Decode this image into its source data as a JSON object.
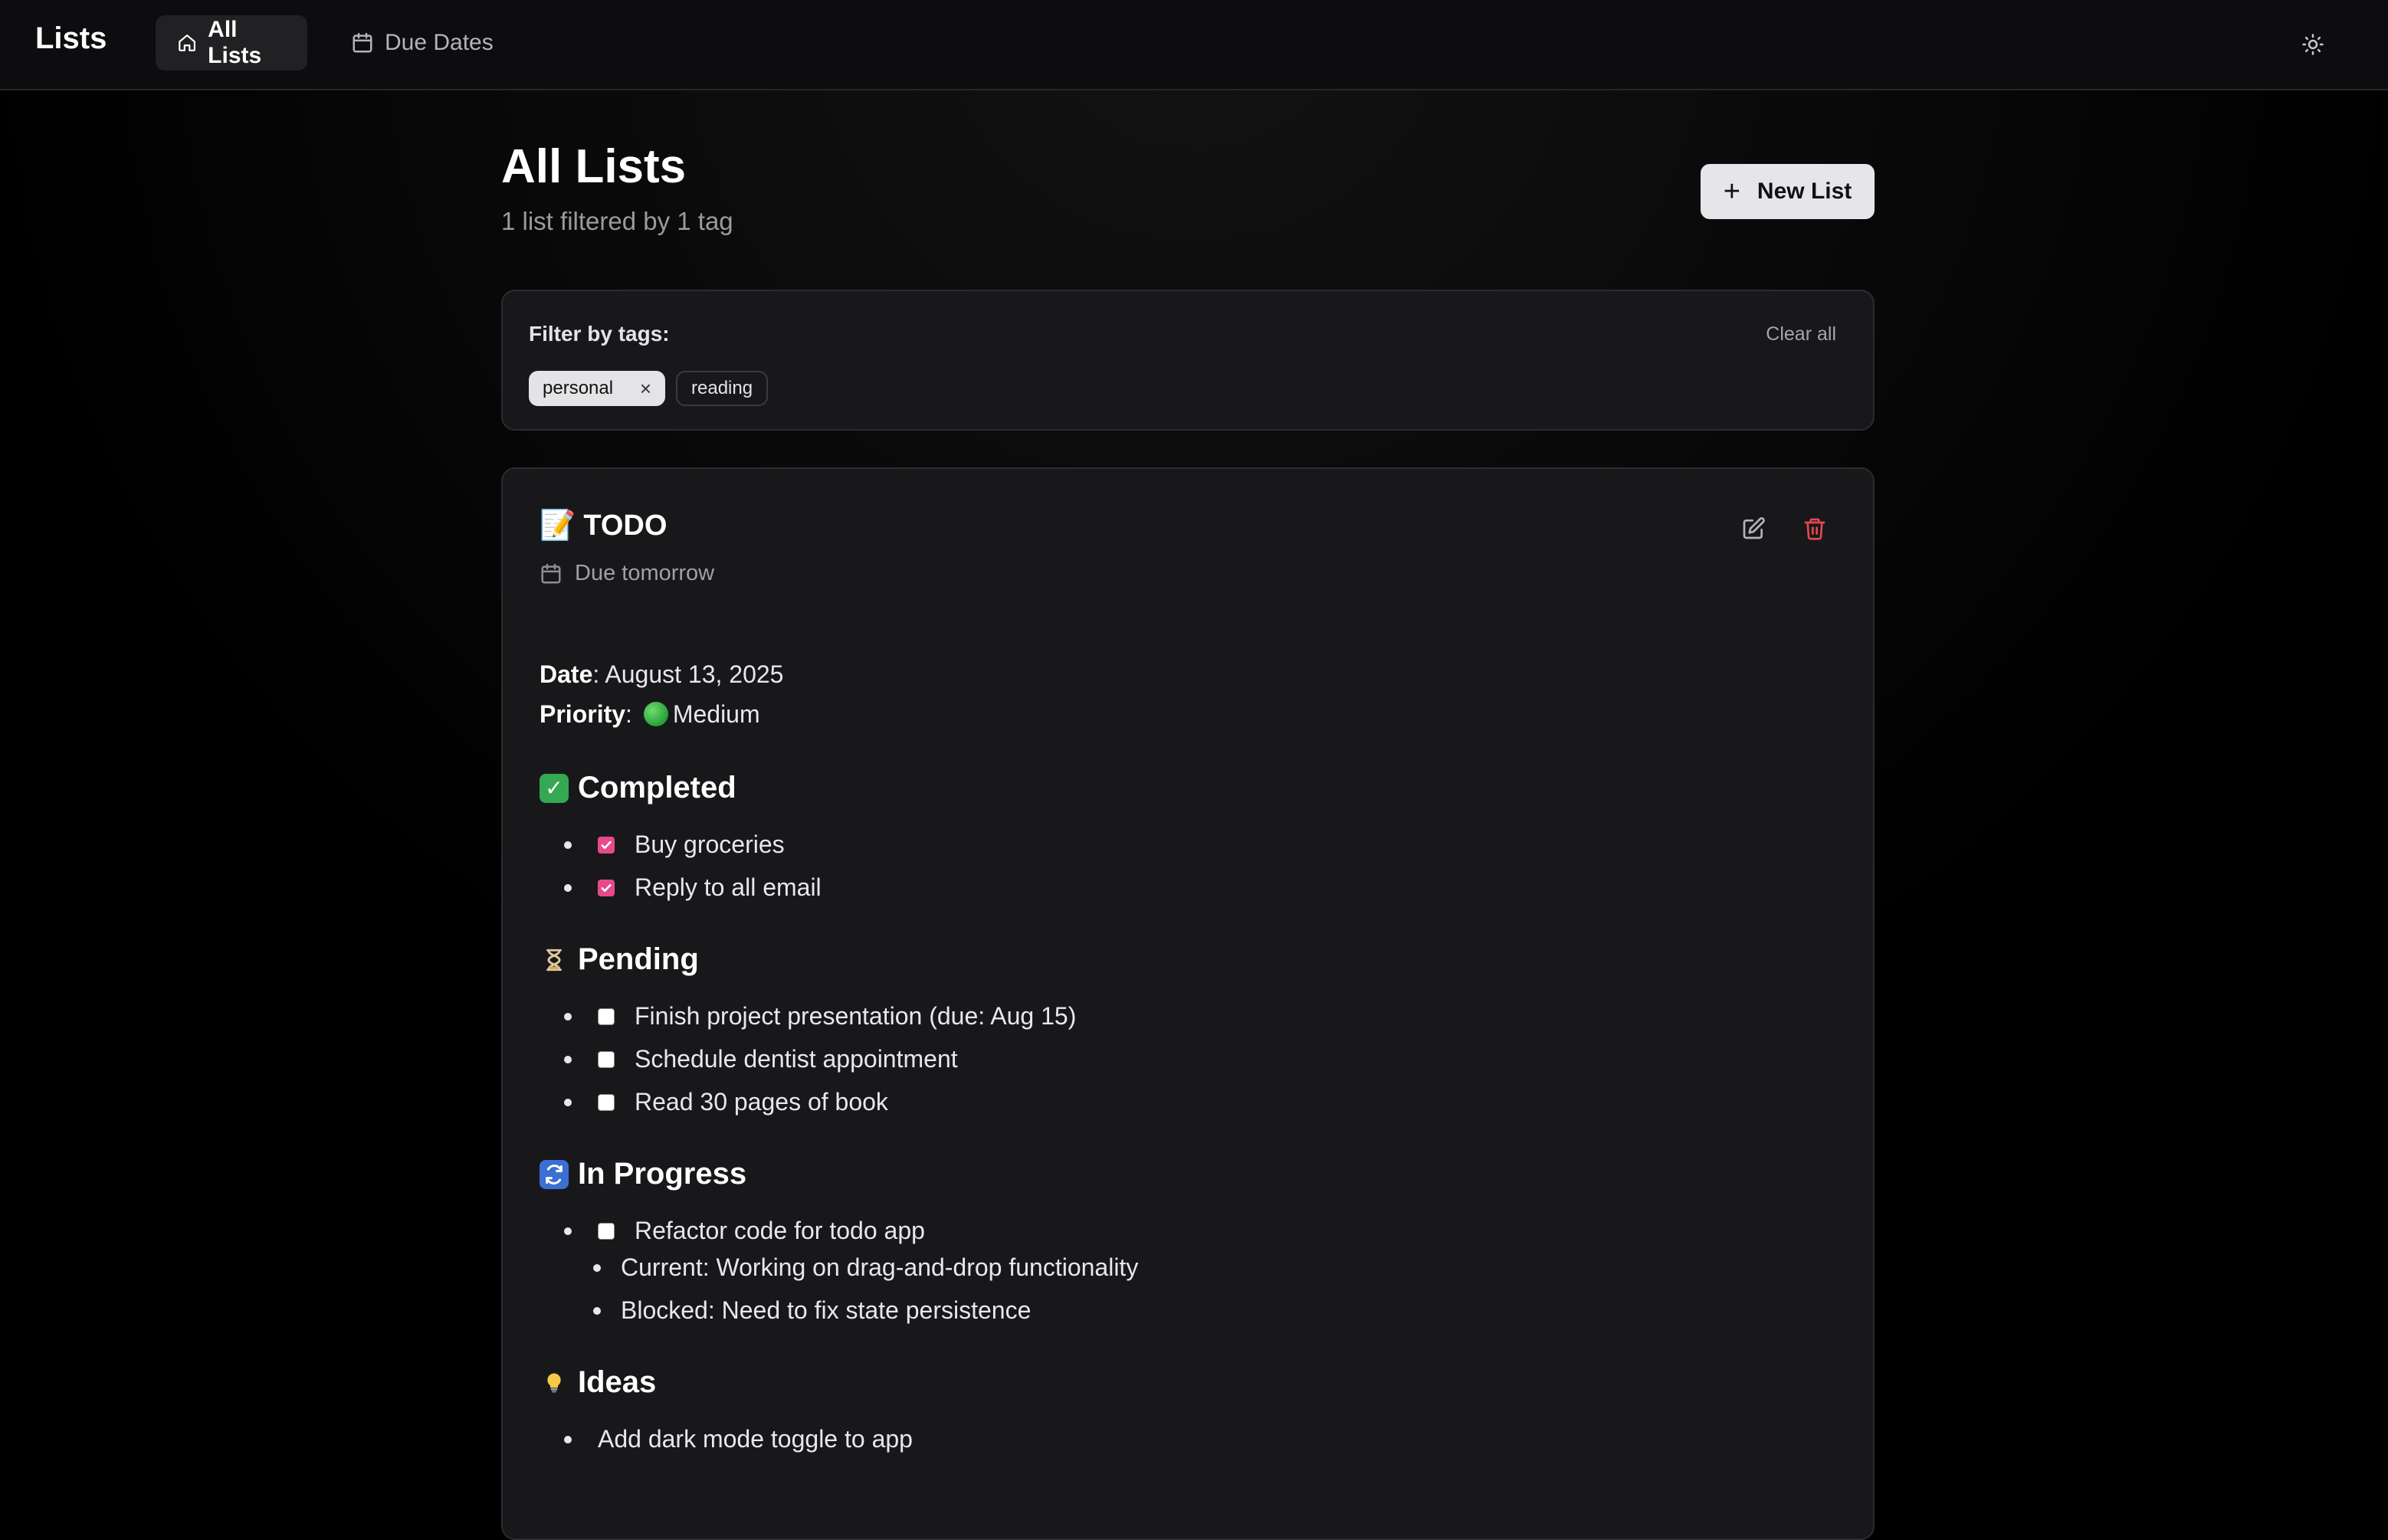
{
  "nav": {
    "brand": "Lists",
    "items": [
      {
        "label": "All Lists",
        "icon": "home-icon",
        "active": true
      },
      {
        "label": "Due Dates",
        "icon": "calendar-icon",
        "active": false
      }
    ],
    "theme_toggle_icon": "sun-icon"
  },
  "header": {
    "title": "All Lists",
    "subtitle": "1 list filtered by 1 tag",
    "new_list_label": "New List"
  },
  "filter": {
    "label": "Filter by tags:",
    "clear_label": "Clear all",
    "tags": [
      {
        "label": "personal",
        "selected": true
      },
      {
        "label": "reading",
        "selected": false
      }
    ]
  },
  "card": {
    "title_emoji": "📝",
    "title": "TODO",
    "due": "Due tomorrow",
    "date_label": "Date",
    "date_value": ": August 13, 2025",
    "priority_label": "Priority",
    "priority_value": "Medium",
    "priority_color": "#2fb84a",
    "sections": {
      "completed": {
        "emoji": "✅",
        "title": "Completed",
        "items": [
          "Buy groceries",
          "Reply to all email"
        ]
      },
      "pending": {
        "emoji": "⏳",
        "title": "Pending",
        "items": [
          "Finish project presentation (due: Aug 15)",
          "Schedule dentist appointment",
          "Read 30 pages of book"
        ]
      },
      "in_progress": {
        "emoji": "🔄",
        "title": "In Progress",
        "item": "Refactor code for todo app",
        "subitems": [
          "Current: Working on drag-and-drop functionality",
          "Blocked: Need to fix state persistence"
        ]
      },
      "ideas": {
        "emoji": "💡",
        "title": "Ideas",
        "items": [
          "Add dark mode toggle to app"
        ]
      }
    }
  },
  "colors": {
    "checkbox_checked": "#e64a8b",
    "delete_icon": "#e5484d",
    "background": "#000000",
    "card_background": "#18181b"
  }
}
